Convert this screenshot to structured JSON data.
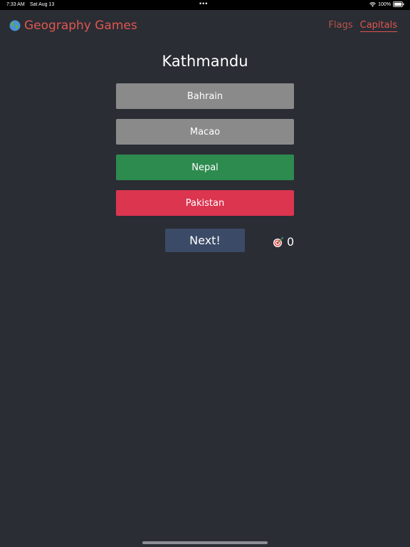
{
  "status_bar": {
    "time": "7:33 AM",
    "date": "Sat Aug 13",
    "dots": "•••",
    "battery": "100%"
  },
  "header": {
    "title": "Geography Games",
    "nav": [
      {
        "label": "Flags",
        "active": false
      },
      {
        "label": "Capitals",
        "active": true
      }
    ]
  },
  "quiz": {
    "question": "Kathmandu",
    "answers": [
      {
        "label": "Bahrain",
        "state": "neutral",
        "color": "#8a8a8a"
      },
      {
        "label": "Macao",
        "state": "neutral",
        "color": "#8a8a8a"
      },
      {
        "label": "Nepal",
        "state": "correct",
        "color": "#2e8b4f"
      },
      {
        "label": "Pakistan",
        "state": "wrong",
        "color": "#dc3550"
      }
    ],
    "next_label": "Next!",
    "score": "0"
  },
  "icons": {
    "brand": "globe-icon",
    "score": "target-icon",
    "wifi": "wifi-icon",
    "battery": "battery-icon"
  },
  "colors": {
    "background": "#2a2d34",
    "accent": "#e0564f",
    "next_button": "#3b4a66"
  }
}
